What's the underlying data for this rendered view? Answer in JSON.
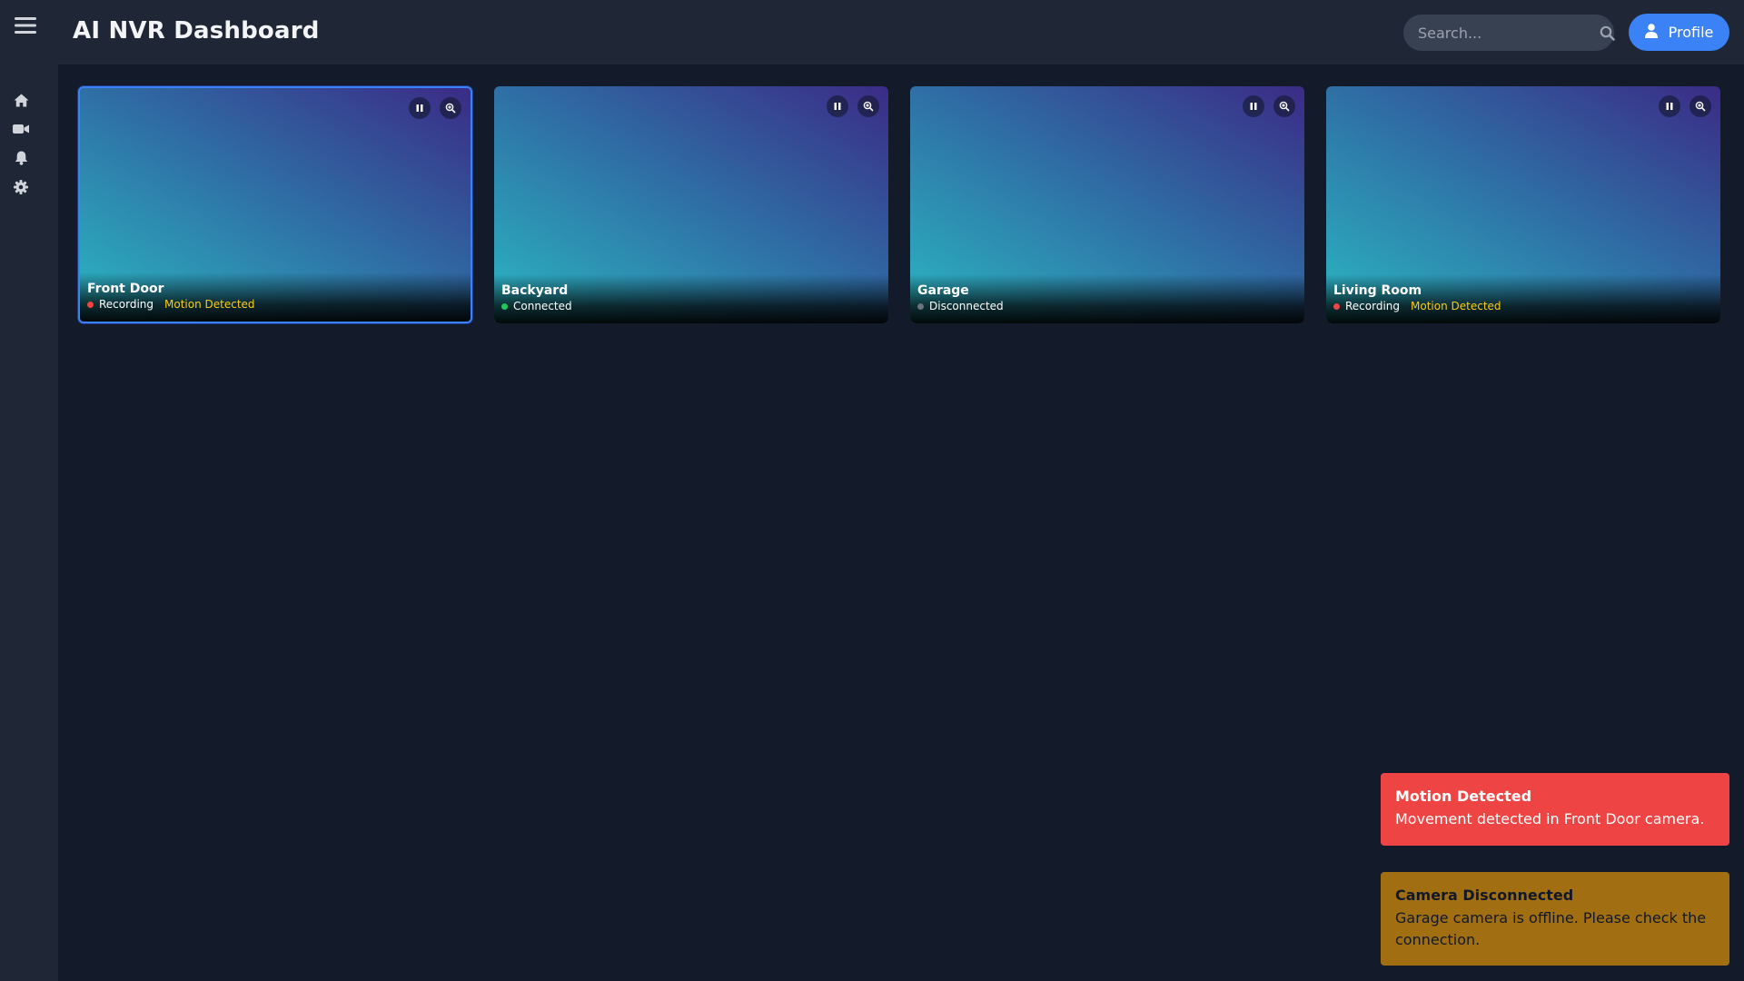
{
  "header": {
    "title": "AI NVR Dashboard",
    "search_placeholder": "Search...",
    "profile_label": "Profile"
  },
  "sidebar": {
    "items": [
      {
        "icon": "home-icon"
      },
      {
        "icon": "video-camera-icon"
      },
      {
        "icon": "bell-icon"
      },
      {
        "icon": "gear-icon"
      }
    ]
  },
  "cameras": [
    {
      "name": "Front Door",
      "status": "Recording",
      "status_color": "#ef4444",
      "motion": "Motion Detected",
      "selected": true
    },
    {
      "name": "Backyard",
      "status": "Connected",
      "status_color": "#22c55e",
      "motion": "",
      "selected": false
    },
    {
      "name": "Garage",
      "status": "Disconnected",
      "status_color": "#6b7280",
      "motion": "",
      "selected": false
    },
    {
      "name": "Living Room",
      "status": "Recording",
      "status_color": "#ef4444",
      "motion": "Motion Detected",
      "selected": false
    }
  ],
  "toasts": [
    {
      "title": "Motion Detected",
      "message": "Movement detected in Front Door camera.",
      "color": "#ef4444"
    },
    {
      "title": "Camera Disconnected",
      "message": "Garage camera is offline. Please check the connection.",
      "color": "#a16f12"
    }
  ],
  "colors": {
    "accent": "#3b82f6",
    "background": "#131a2a",
    "panel": "#1f2736",
    "motion": "#facc15"
  }
}
